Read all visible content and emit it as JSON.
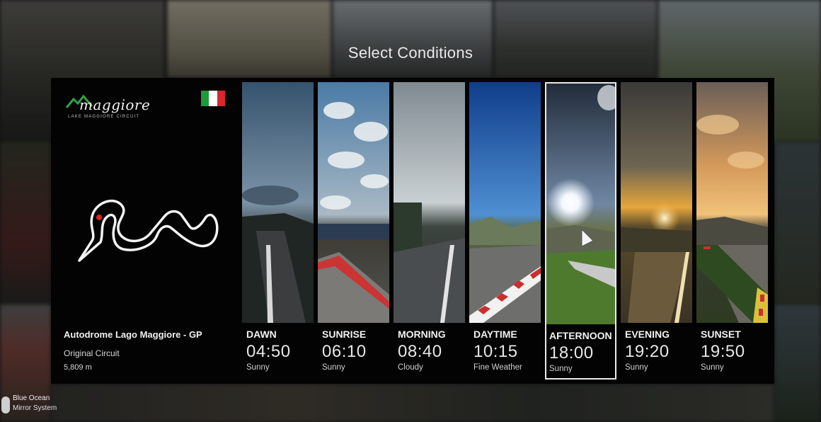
{
  "screen": {
    "title": "Select Conditions"
  },
  "track": {
    "logo_word": "maggiore",
    "logo_subtitle": "LAKE MAGGIORE CIRCUIT",
    "name": "Autodrome Lago Maggiore - GP",
    "layout": "Original Circuit",
    "length": "5,809 m",
    "flag_colors": [
      "#1f9a3a",
      "#ffffff",
      "#d9262f"
    ]
  },
  "conditions": [
    {
      "name": "DAWN",
      "time": "04:50",
      "weather": "Sunny",
      "selected": false
    },
    {
      "name": "SUNRISE",
      "time": "06:10",
      "weather": "Sunny",
      "selected": false
    },
    {
      "name": "MORNING",
      "time": "08:40",
      "weather": "Cloudy",
      "selected": false
    },
    {
      "name": "DAYTIME",
      "time": "10:15",
      "weather": "Fine Weather",
      "selected": false
    },
    {
      "name": "AFTERNOON",
      "time": "18:00",
      "weather": "Sunny",
      "selected": true
    },
    {
      "name": "EVENING",
      "time": "19:20",
      "weather": "Sunny",
      "selected": false
    },
    {
      "name": "SUNSET",
      "time": "19:50",
      "weather": "Sunny",
      "selected": false
    }
  ],
  "now_playing": {
    "track": "Blue Ocean",
    "artist": "Mirror System"
  }
}
